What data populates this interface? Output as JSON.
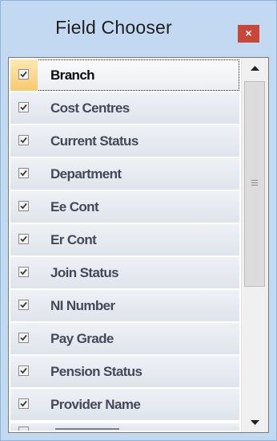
{
  "window": {
    "title": "Field Chooser",
    "close_label": "×"
  },
  "fields": [
    {
      "label": "Branch",
      "checked": true,
      "selected": true
    },
    {
      "label": "Cost Centres",
      "checked": true
    },
    {
      "label": "Current Status",
      "checked": true
    },
    {
      "label": "Department",
      "checked": true
    },
    {
      "label": "Ee Cont",
      "checked": true
    },
    {
      "label": "Er Cont",
      "checked": true
    },
    {
      "label": "Join Status",
      "checked": true
    },
    {
      "label": "NI Number",
      "checked": true
    },
    {
      "label": "Pay Grade",
      "checked": true
    },
    {
      "label": "Pension Status",
      "checked": true
    },
    {
      "label": "Provider Name",
      "checked": true
    }
  ],
  "icons": {
    "close": "close-icon",
    "scroll_up": "scroll-up-arrow-icon",
    "scroll_down": "scroll-down-arrow-icon",
    "checkbox": "checkmark-icon"
  },
  "colors": {
    "close_button": "#c7473b",
    "window_frame": "#c3d9f1",
    "selected_check_cell": "#f8c96d"
  }
}
